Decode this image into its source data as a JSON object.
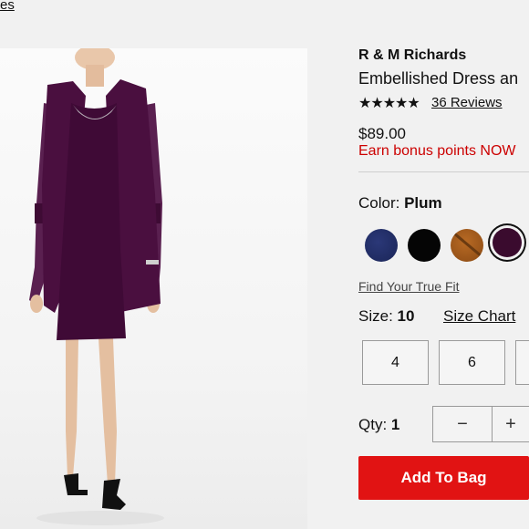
{
  "breadcrumb": {
    "link_text": "es"
  },
  "product": {
    "brand": "R & M Richards",
    "title": "Embellished Dress an",
    "rating": {
      "stars_text": "★★★★★",
      "value": 4.5,
      "reviews_text": "36 Reviews"
    },
    "price": "$89.00",
    "bonus_text": "Earn bonus points NOW"
  },
  "color": {
    "label": "Color:",
    "selected": "Plum",
    "swatches": [
      {
        "name": "navy",
        "hex": "#1f2b63"
      },
      {
        "name": "black",
        "hex": "#050505"
      },
      {
        "name": "bronze",
        "hex": "#9c561b"
      },
      {
        "name": "plum",
        "hex": "#3a0b2e",
        "selected": true
      }
    ]
  },
  "fit": {
    "true_fit_text": "Find Your True Fit"
  },
  "size": {
    "label": "Size:",
    "selected": "10",
    "chart_link": "Size Chart",
    "options": [
      "4",
      "6",
      ""
    ]
  },
  "qty": {
    "label": "Qty:",
    "value": "1",
    "minus": "−",
    "plus": "+"
  },
  "cart": {
    "button_label": "Add To Bag",
    "color": "#e11313"
  }
}
